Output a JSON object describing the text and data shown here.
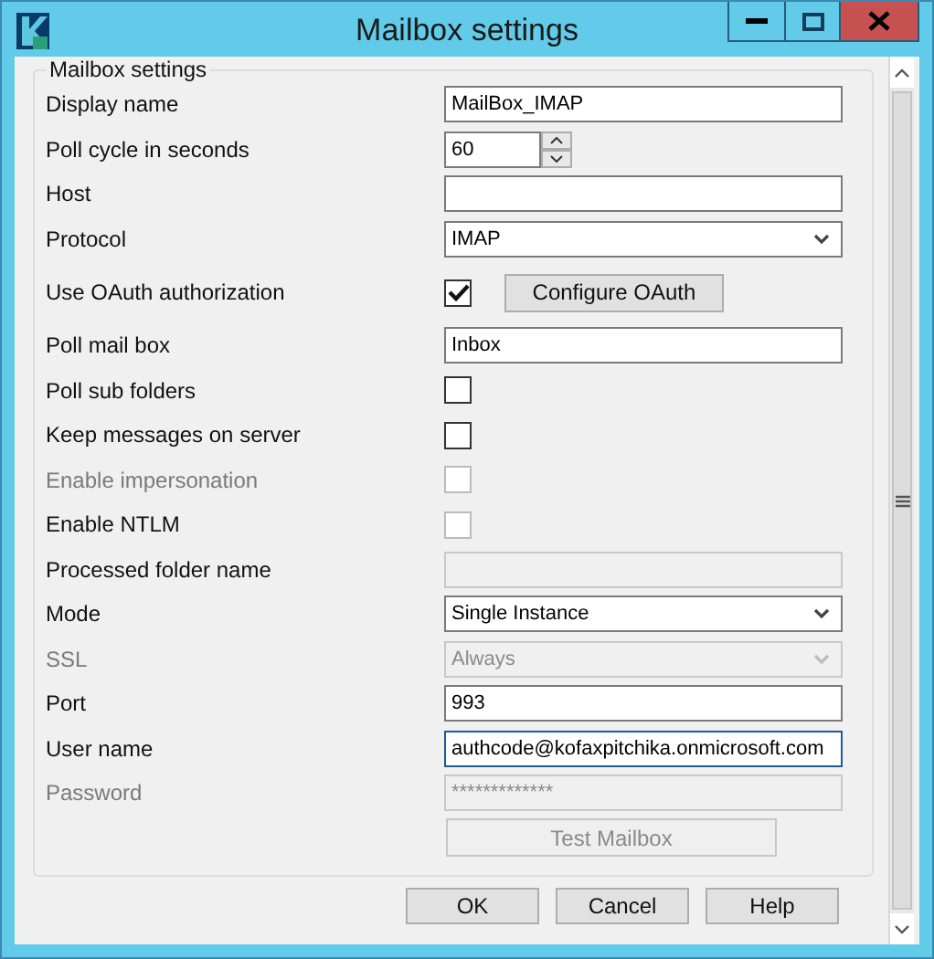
{
  "window": {
    "title": "Mailbox settings"
  },
  "group": {
    "title": "Mailbox settings"
  },
  "rows": [
    {
      "kind": "text",
      "label": "Display name",
      "label_disabled": false,
      "value": "MailBox_IMAP",
      "disabled": false
    },
    {
      "kind": "spin",
      "label": "Poll cycle in seconds",
      "label_disabled": false,
      "value": "60",
      "disabled": false
    },
    {
      "kind": "text",
      "label": "Host",
      "label_disabled": false,
      "disabled": false
    },
    {
      "kind": "select",
      "label": "Protocol",
      "label_disabled": false,
      "value": "IMAP",
      "disabled": false
    },
    {
      "kind": "checkbox",
      "label": "Use OAuth authorization",
      "label_disabled": false,
      "checked": true,
      "disabled": false,
      "button": "Configure OAuth"
    },
    {
      "kind": "text",
      "label": "Poll mail box",
      "label_disabled": false,
      "value": "Inbox",
      "disabled": false
    },
    {
      "kind": "checkbox",
      "label": "Poll sub folders",
      "label_disabled": false,
      "checked": false,
      "disabled": false
    },
    {
      "kind": "checkbox",
      "label": "Keep messages on server",
      "label_disabled": false,
      "checked": false,
      "disabled": false
    },
    {
      "kind": "checkbox",
      "label": "Enable impersonation",
      "label_disabled": true,
      "checked": false,
      "disabled": true
    },
    {
      "kind": "checkbox",
      "label": "Enable NTLM",
      "label_disabled": false,
      "checked": false,
      "disabled": true
    },
    {
      "kind": "text",
      "label": "Processed folder name",
      "label_disabled": false,
      "disabled": true
    },
    {
      "kind": "select",
      "label": "Mode",
      "label_disabled": false,
      "value": "Single Instance",
      "disabled": false
    },
    {
      "kind": "select",
      "label": "SSL",
      "label_disabled": true,
      "value": "Always",
      "disabled": true
    },
    {
      "kind": "text",
      "label": "Port",
      "label_disabled": false,
      "value": "993",
      "disabled": false
    },
    {
      "kind": "text",
      "label": "User name",
      "label_disabled": false,
      "value": "authcode@kofaxpitchika.onmicrosoft.com",
      "disabled": false,
      "focused": true
    },
    {
      "kind": "text",
      "label": "Password",
      "label_disabled": true,
      "value": "*************",
      "disabled": true
    },
    {
      "kind": "button",
      "label": "Test Mailbox",
      "disabled": true
    }
  ],
  "buttons": [
    "OK",
    "Cancel",
    "Help"
  ]
}
